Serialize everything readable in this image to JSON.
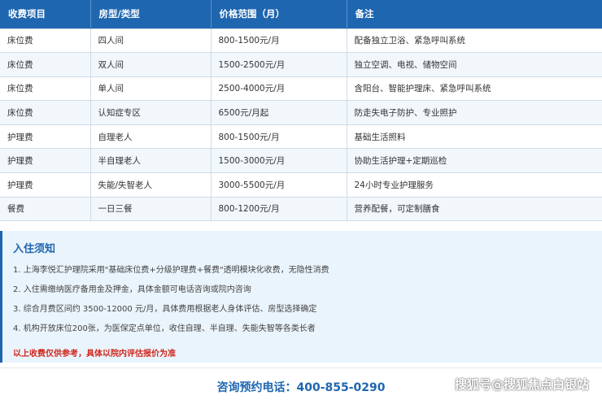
{
  "table": {
    "headers": [
      "收费项目",
      "房型/类型",
      "价格范围（月）",
      "备注"
    ],
    "rows": [
      [
        "床位费",
        "四人间",
        "800-1500元/月",
        "配备独立卫浴、紧急呼叫系统"
      ],
      [
        "床位费",
        "双人间",
        "1500-2500元/月",
        "独立空调、电视、储物空间"
      ],
      [
        "床位费",
        "单人间",
        "2500-4000元/月",
        "含阳台、智能护理床、紧急呼叫系统"
      ],
      [
        "床位费",
        "认知症专区",
        "6500元/月起",
        "防走失电子防护、专业照护"
      ],
      [
        "护理费",
        "自理老人",
        "800-1500元/月",
        "基础生活照料"
      ],
      [
        "护理费",
        "半自理老人",
        "1500-3000元/月",
        "协助生活护理+定期巡检"
      ],
      [
        "护理费",
        "失能/失智老人",
        "3000-5500元/月",
        "24小时专业护理服务"
      ],
      [
        "餐费",
        "一日三餐",
        "800-1200元/月",
        "营养配餐，可定制膳食"
      ]
    ]
  },
  "notice": {
    "title": "入住须知",
    "items": [
      "1. 上海李悦汇护理院采用\"基础床位费+分级护理费+餐费\"透明模块化收费，无隐性消费",
      "2. 入住需缴纳医疗备用金及押金，具体金额可电话咨询或院内咨询",
      "3. 综合月费区间约 3500-12000 元/月，具体费用根据老人身体评估、房型选择确定",
      "4. 机构开放床位200张，为医保定点单位，收住自理、半自理、失能失智等各类长者"
    ],
    "warning": "以上收费仅供参考，具体以院内评估报价为准"
  },
  "contact": {
    "phone_text": "咨询预约电话：400-855-0290"
  },
  "watermark": "搜狐号@搜狐焦点白银站",
  "colors": {
    "header_blue": "#1f66b0",
    "warning_red": "#d0271d",
    "notice_bg": "#eaf4fc"
  }
}
